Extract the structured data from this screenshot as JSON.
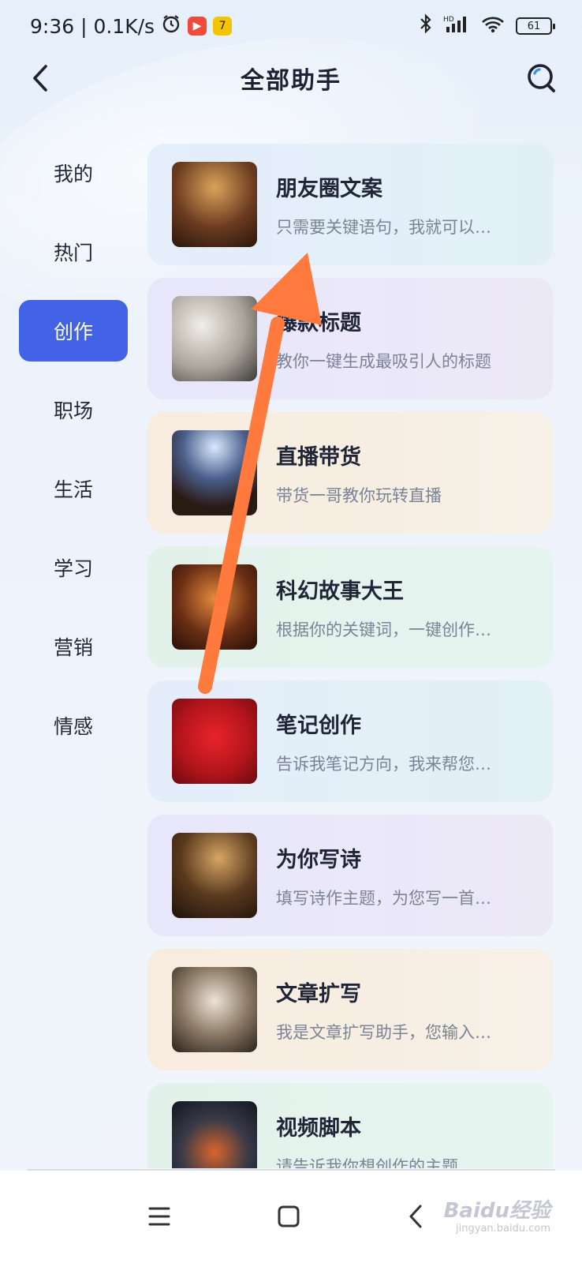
{
  "status_bar": {
    "time_speed": "9:36 | 0.1K/s",
    "battery": "61"
  },
  "header": {
    "title": "全部助手"
  },
  "sidebar": {
    "items": [
      {
        "label": "我的"
      },
      {
        "label": "热门"
      },
      {
        "label": "创作"
      },
      {
        "label": "职场"
      },
      {
        "label": "生活"
      },
      {
        "label": "学习"
      },
      {
        "label": "营销"
      },
      {
        "label": "情感"
      }
    ],
    "active": "创作"
  },
  "cards": [
    {
      "title": "朋友圈文案",
      "desc": "只需要关键语句，我就可以…"
    },
    {
      "title": "爆款标题",
      "desc": "教你一键生成最吸引人的标题"
    },
    {
      "title": "直播带货",
      "desc": "带货一哥教你玩转直播"
    },
    {
      "title": "科幻故事大王",
      "desc": "根据你的关键词，一键创作…"
    },
    {
      "title": "笔记创作",
      "desc": "告诉我笔记方向，我来帮您…"
    },
    {
      "title": "为你写诗",
      "desc": "填写诗作主题，为您写一首…"
    },
    {
      "title": "文章扩写",
      "desc": "我是文章扩写助手，您输入…"
    },
    {
      "title": "视频脚本",
      "desc": "请告诉我你想创作的主题"
    }
  ],
  "watermark": {
    "text": "Baidu经验",
    "sub": "jingyan.baidu.com"
  },
  "colors": {
    "accent": "#4363e6",
    "arrow": "#ff7a3c"
  },
  "icons": {
    "back": "chevron-left-icon",
    "search": "search-icon",
    "menu": "menu-icon",
    "home": "home-icon",
    "nav_back": "back-icon"
  }
}
